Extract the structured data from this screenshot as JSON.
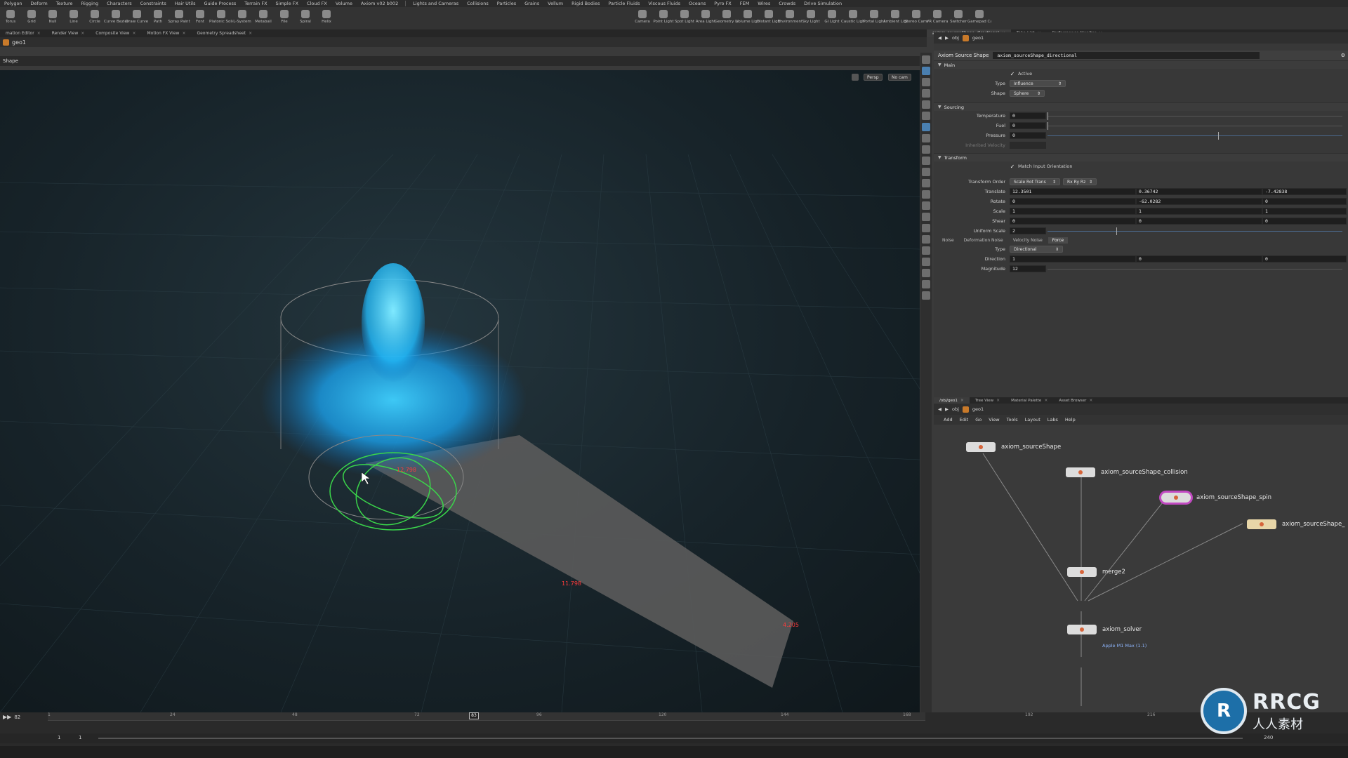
{
  "top_menu": [
    "Polygon",
    "Deform",
    "Texture",
    "Rigging",
    "Characters",
    "Constraints",
    "Hair Utils",
    "Guide Process",
    "Terrain FX",
    "Simple FX",
    "Cloud FX",
    "Volume",
    "Axiom v02 b002",
    "Lights and Cameras",
    "Collisions",
    "Particles",
    "Grains",
    "Vellum",
    "Rigid Bodies",
    "Particle Fluids",
    "Viscous Fluids",
    "Oceans",
    "Pyro FX",
    "FEM",
    "Wires",
    "Crowds",
    "Drive Simulation"
  ],
  "shelf_left": [
    "Torus",
    "Grid",
    "Null",
    "Line",
    "Circle",
    "Curve Bezier",
    "Draw Curve",
    "Path",
    "Spray Paint",
    "Font",
    "Platonic Solids",
    "L-System",
    "Metaball",
    "File",
    "Spiral",
    "Helix"
  ],
  "shelf_right": [
    "Camera",
    "Point Light",
    "Spot Light",
    "Area Light",
    "Geometry Light",
    "Volume Light",
    "Distant Light",
    "Environment Light",
    "Sky Light",
    "GI Light",
    "Caustic Light",
    "Portal Light",
    "Ambient Light",
    "Stereo Camera",
    "VR Camera",
    "Switcher",
    "Gamepad Camera"
  ],
  "pane_tabs_left": [
    "mation Editor",
    "Render View",
    "Composite View",
    "Motion FX View",
    "Geometry Spreadsheet"
  ],
  "pane_tabs_right": [
    "axiom_sourceShape_directional",
    "Take List",
    "Performance Monitor"
  ],
  "viewport": {
    "path_label": "geo1",
    "title": "Shape",
    "persp_btn": "Persp",
    "cam_btn": "No cam"
  },
  "params": {
    "breadcrumb": [
      "obj",
      "geo1"
    ],
    "node_type": "Axiom Source Shape",
    "node_name": "axiom_sourceShape_directional",
    "sections": {
      "main": "Main",
      "sourcing": "Sourcing",
      "transform": "Transform"
    },
    "active_label": "Active",
    "type_label": "Type",
    "type_value": "Influence",
    "shape_label": "Shape",
    "shape_value": "Sphere",
    "temperature_label": "Temperature",
    "temperature_value": "0",
    "fuel_label": "Fuel",
    "fuel_value": "0",
    "pressure_label": "Pressure",
    "pressure_value": "0",
    "inherited_velocity_label": "Inherited Velocity",
    "match_orient_label": "Match Input Orientation",
    "transform_order_label": "Transform Order",
    "transform_order_value": "Scale Rot Trans",
    "rot_order_value": "Rx Ry Rz",
    "translate_label": "Translate",
    "translate": [
      "12.3501",
      "0.36742",
      "-7.42838"
    ],
    "rotate_label": "Rotate",
    "rotate": [
      "0",
      "-62.0282",
      "0"
    ],
    "scale_label": "Scale",
    "scale": [
      "1",
      "1",
      "1"
    ],
    "shear_label": "Shear",
    "shear": [
      "0",
      "0",
      "0"
    ],
    "uniform_scale_label": "Uniform Scale",
    "uniform_scale_value": "2",
    "subtabs": [
      "Noise",
      "Deformation Noise",
      "Velocity Noise",
      "Force"
    ],
    "force_type_label": "Type",
    "force_type_value": "Directional",
    "direction_label": "Direction",
    "direction": [
      "1",
      "0",
      "0"
    ],
    "magnitude_label": "Magnitude",
    "magnitude_value": "12"
  },
  "network": {
    "tabs": [
      "/obj/geo1",
      "Tree View",
      "Material Palette",
      "Asset Browser"
    ],
    "breadcrumb": [
      "obj",
      "geo1"
    ],
    "menu": [
      "Add",
      "Edit",
      "Go",
      "View",
      "Tools",
      "Layout",
      "Labs",
      "Help"
    ],
    "nodes": {
      "n1": "axiom_sourceShape",
      "n2": "axiom_sourceShape_collision",
      "n3": "axiom_sourceShape_spin",
      "n4": "axiom_sourceShape_",
      "n5": "merge2",
      "n6": "axiom_solver"
    },
    "solver_sub": "Apple M1 Max (1.1)"
  },
  "timeline": {
    "ticks": [
      "1",
      "24",
      "48",
      "72",
      "96",
      "120",
      "144",
      "168",
      "192",
      "216"
    ],
    "current_frame": "83",
    "frame_field": "82",
    "start": "1",
    "start2": "1",
    "end": "240"
  },
  "viewport_labels": [
    "12.798",
    "11.798",
    "4.205"
  ],
  "watermark": {
    "logo": "R",
    "title": "RRCG",
    "subtitle": "人人素材"
  }
}
